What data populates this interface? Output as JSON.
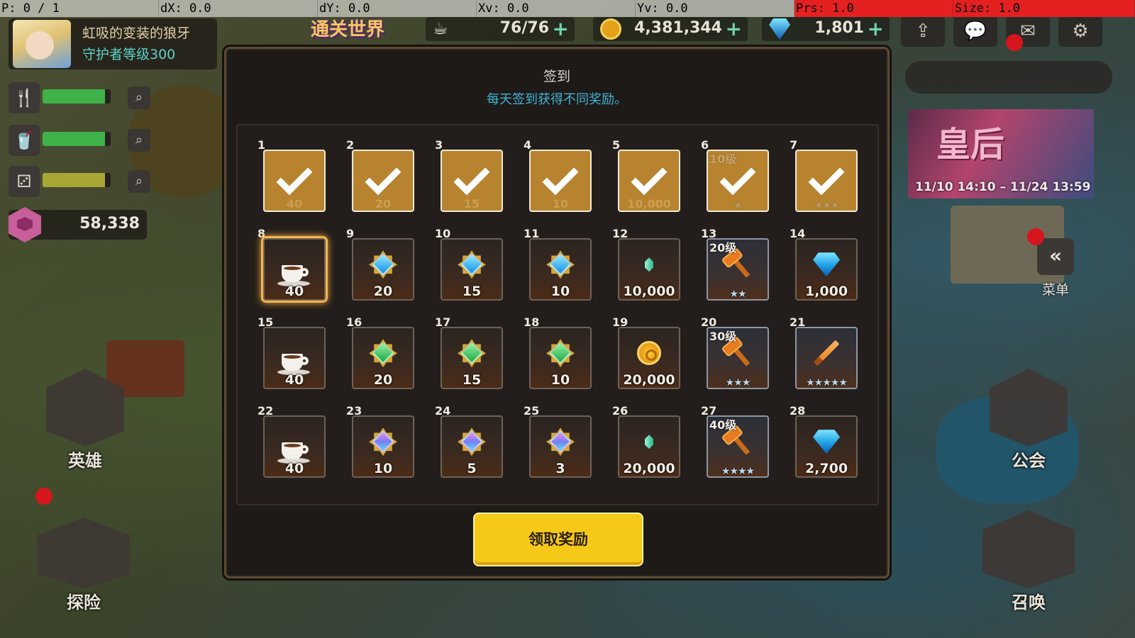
{
  "debug": {
    "p": "P: 0 / 1",
    "dx": "dX: 0.0",
    "dy": "dY: 0.0",
    "xv": "Xv: 0.0",
    "yv": "Yv: 0.0",
    "prs": "Prs: 1.0",
    "size": "Size: 1.0"
  },
  "profile": {
    "name": "虹吸的变装的狼牙",
    "level": "守护者等级300"
  },
  "hud": {
    "banner": "通关世界",
    "stamina": "76/76",
    "gold": "4,381,344",
    "gems": "1,801",
    "crystals": "58,338"
  },
  "side": {
    "heroes": "英雄",
    "explore": "探险",
    "guild": "公会",
    "summon": "召唤",
    "menu": "菜单",
    "event_title": "皇后",
    "event_dates": "11/10 14:10 – 11/24 13:59"
  },
  "colors": {
    "accent_yellow": "#f6c919",
    "subtitle_blue": "#43b4d6",
    "claimed_gold": "#b8832f",
    "today_glow": "#f3b64a"
  },
  "dialog": {
    "title": "签到",
    "subtitle": "每天签到获得不同奖励。",
    "claim_button": "领取奖励",
    "days": [
      {
        "day": "1",
        "qty": "40",
        "item": "coffee-icon",
        "claimed": true
      },
      {
        "day": "2",
        "qty": "20",
        "item": "blue-gem-icon",
        "claimed": true
      },
      {
        "day": "3",
        "qty": "15",
        "item": "blue-gem-icon",
        "claimed": true
      },
      {
        "day": "4",
        "qty": "10",
        "item": "blue-gem-icon",
        "claimed": true
      },
      {
        "day": "5",
        "qty": "10,000",
        "item": "crystal-icon",
        "claimed": true
      },
      {
        "day": "6",
        "lvl": "10级",
        "stars": "★",
        "item": "hammer-icon",
        "claimed": true
      },
      {
        "day": "7",
        "stars": "★★★",
        "item": "sword-icon",
        "claimed": true
      },
      {
        "day": "8",
        "qty": "40",
        "item": "coffee-icon",
        "today": true
      },
      {
        "day": "9",
        "qty": "20",
        "item": "blue-gem-icon"
      },
      {
        "day": "10",
        "qty": "15",
        "item": "blue-gem-icon"
      },
      {
        "day": "11",
        "qty": "10",
        "item": "blue-gem-icon"
      },
      {
        "day": "12",
        "qty": "10,000",
        "item": "crystal-icon"
      },
      {
        "day": "13",
        "lvl": "20级",
        "stars": "★★",
        "item": "hammer-icon"
      },
      {
        "day": "14",
        "qty": "1,000",
        "item": "diamond-icon"
      },
      {
        "day": "15",
        "qty": "40",
        "item": "coffee-icon"
      },
      {
        "day": "16",
        "qty": "20",
        "item": "green-gem-icon"
      },
      {
        "day": "17",
        "qty": "15",
        "item": "green-gem-icon"
      },
      {
        "day": "18",
        "qty": "10",
        "item": "green-gem-icon"
      },
      {
        "day": "19",
        "qty": "20,000",
        "item": "gold-coin-icon"
      },
      {
        "day": "20",
        "lvl": "30级",
        "stars": "★★★",
        "item": "hammer-icon"
      },
      {
        "day": "21",
        "stars": "★★★★★",
        "item": "sword-icon"
      },
      {
        "day": "22",
        "qty": "40",
        "item": "coffee-icon"
      },
      {
        "day": "23",
        "qty": "10",
        "item": "rainbow-gem-icon"
      },
      {
        "day": "24",
        "qty": "5",
        "item": "rainbow-gem-icon"
      },
      {
        "day": "25",
        "qty": "3",
        "item": "rainbow-gem-icon"
      },
      {
        "day": "26",
        "qty": "20,000",
        "item": "crystal-icon"
      },
      {
        "day": "27",
        "lvl": "40级",
        "stars": "★★★★",
        "item": "hammer-icon"
      },
      {
        "day": "28",
        "qty": "2,700",
        "item": "diamond-icon"
      }
    ]
  }
}
